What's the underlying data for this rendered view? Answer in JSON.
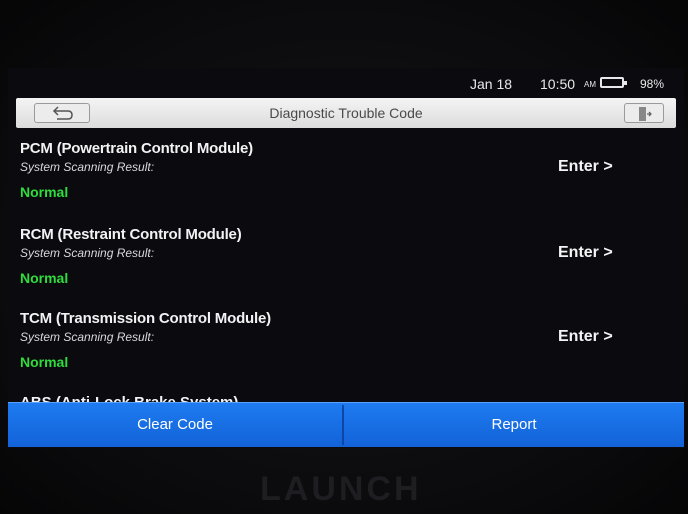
{
  "status_bar": {
    "date": "Jan 18",
    "time": "10:50",
    "ampm": "AM",
    "battery": "98%"
  },
  "header": {
    "title": "Diagnostic Trouble Code",
    "back_icon": "back-arrow-icon",
    "exit_icon": "exit-icon"
  },
  "modules": [
    {
      "name": "PCM (Powertrain Control Module)",
      "subtitle": "System Scanning Result:",
      "status": "Normal",
      "action": "Enter >"
    },
    {
      "name": "RCM (Restraint Control Module)",
      "subtitle": "System Scanning Result:",
      "status": "Normal",
      "action": "Enter >"
    },
    {
      "name": "TCM (Transmission Control Module)",
      "subtitle": "System Scanning Result:",
      "status": "Normal",
      "action": "Enter >"
    },
    {
      "name": "ABS (Anti-Lock Brake System)"
    }
  ],
  "footer": {
    "clear_label": "Clear Code",
    "report_label": "Report"
  },
  "device": {
    "brand": "LAUNCH"
  },
  "colors": {
    "status_normal": "#2fdc3c",
    "button_blue": "#1e7bf0"
  }
}
